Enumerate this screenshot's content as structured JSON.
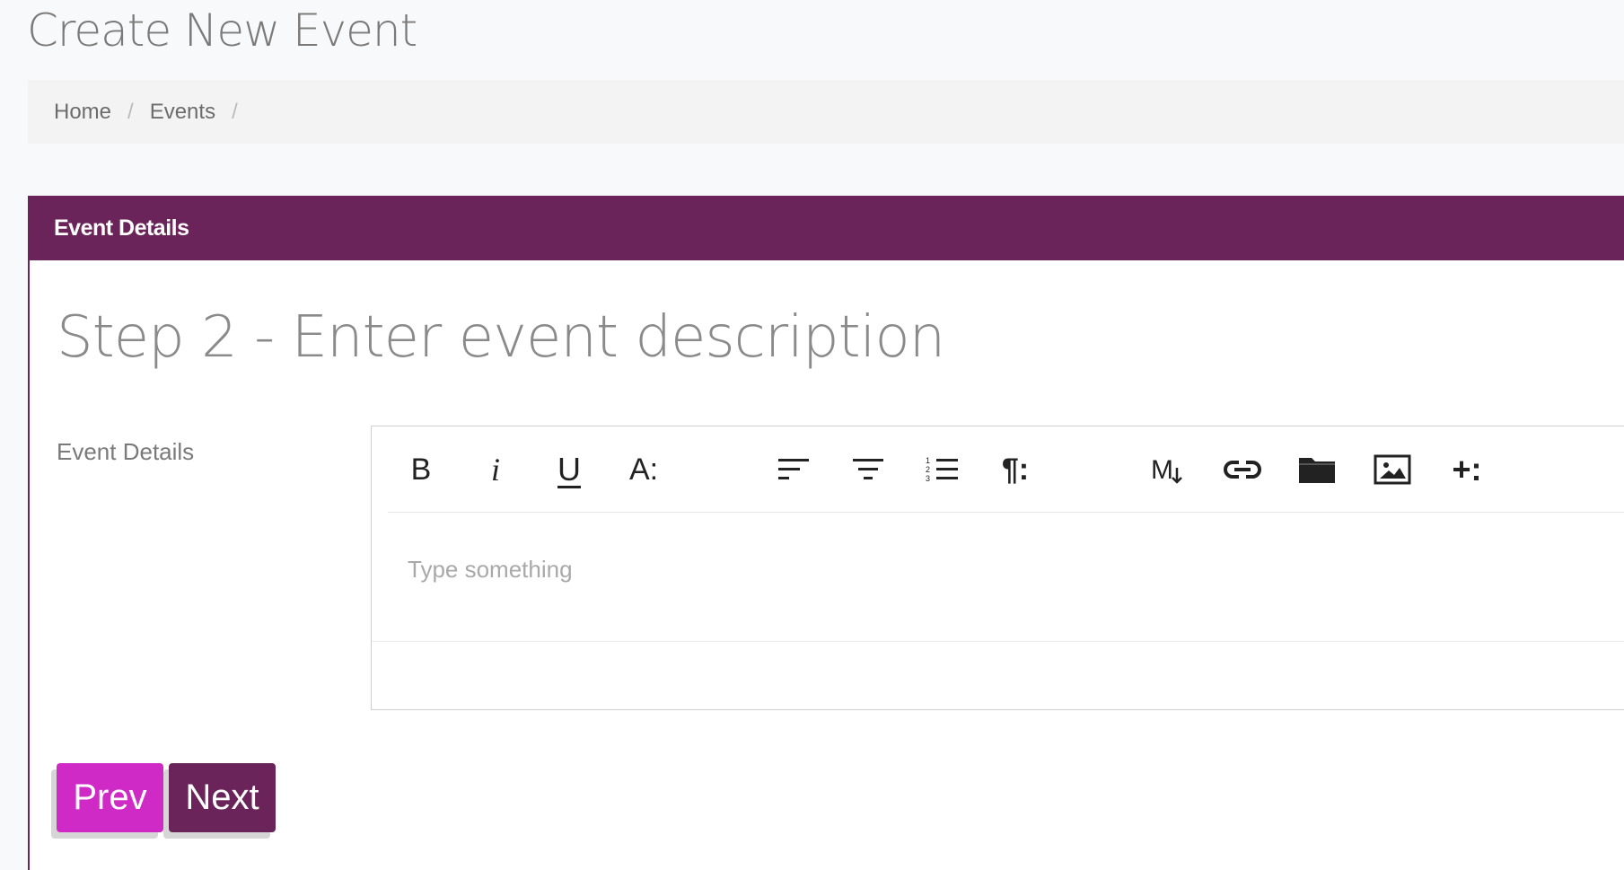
{
  "page": {
    "title": "Create New Event"
  },
  "breadcrumb": {
    "items": [
      "Home",
      "Events"
    ],
    "separator": "/"
  },
  "panel": {
    "header": "Event Details",
    "step_title": "Step 2 - Enter event description",
    "field_label": "Event Details"
  },
  "editor": {
    "placeholder": "Type something",
    "toolbar": [
      {
        "name": "bold-icon",
        "glyph": "B"
      },
      {
        "name": "italic-icon",
        "glyph": "i"
      },
      {
        "name": "underline-icon",
        "glyph": "U"
      },
      {
        "name": "font-size-icon",
        "glyph": "A:"
      },
      {
        "name": "align-left-icon"
      },
      {
        "name": "align-center-icon"
      },
      {
        "name": "ordered-list-icon"
      },
      {
        "name": "paragraph-icon",
        "glyph": "¶:"
      },
      {
        "name": "markdown-icon"
      },
      {
        "name": "link-icon"
      },
      {
        "name": "folder-icon"
      },
      {
        "name": "image-icon"
      },
      {
        "name": "insert-more-icon",
        "glyph": "+:"
      }
    ]
  },
  "buttons": {
    "prev": "Prev",
    "next": "Next"
  },
  "colors": {
    "accent": "#6b2459",
    "prev_button": "#d02ac6"
  }
}
